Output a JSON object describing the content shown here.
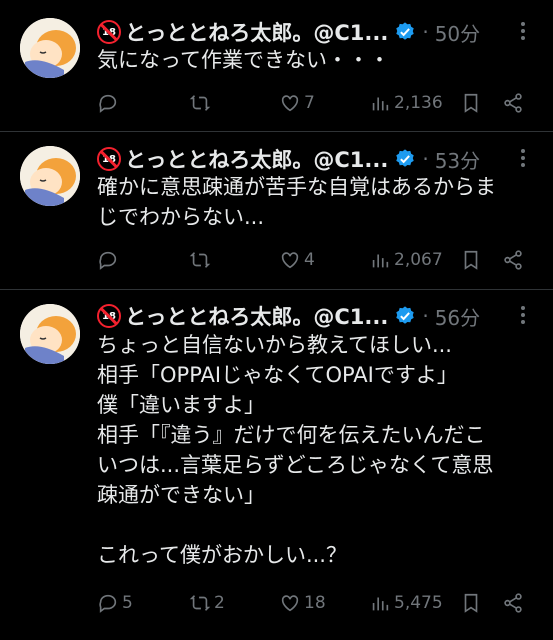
{
  "tweets": [
    {
      "name": "とっととねろ太郎。@C1...",
      "time": "50分",
      "text": "気になって作業できない・・・",
      "replies": "",
      "retweets": "",
      "likes": "7",
      "views": "2,136"
    },
    {
      "name": "とっととねろ太郎。@C1...",
      "time": "53分",
      "text": "確かに意思疎通が苦手な自覚はあるからま\nじでわからない...",
      "replies": "",
      "retweets": "",
      "likes": "4",
      "views": "2,067"
    },
    {
      "name": "とっととねろ太郎。@C1...",
      "time": "56分",
      "text": "ちょっと自信ないから教えてほしい...\n相手「OPPAIじゃなくてOPAIですよ」\n僕「違いますよ」\n相手「『違う』だけで何を伝えたいんだこ\nいつは...言葉足らずどころじゃなくて意思\n疎通ができない」\n\nこれって僕がおかしい...？",
      "replies": "5",
      "retweets": "2",
      "likes": "18",
      "views": "5,475"
    }
  ],
  "icons": {
    "age_badge": "18",
    "verified_color": "#1d9bf0",
    "muted_color": "#71767b"
  }
}
